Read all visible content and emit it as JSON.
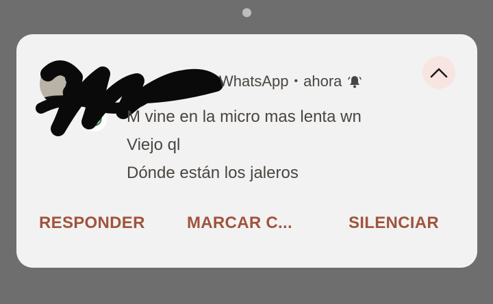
{
  "notification": {
    "app_name": "WhatsApp",
    "separator": "•",
    "time": "ahora",
    "icons": {
      "app_badge": "whatsapp-icon",
      "bell": "bell-icon",
      "collapse": "chevron-up-icon"
    },
    "messages": [
      "M vine en la micro mas lenta wn",
      "Viejo ql",
      "Dónde están los jaleros"
    ],
    "actions": {
      "reply": "RESPONDER",
      "mark": "MARCAR C...",
      "mute": "SILENCIAR"
    }
  },
  "colors": {
    "background": "#6e6e6e",
    "card": "#f2f2f2",
    "action_text": "#a0533d",
    "whatsapp": "#2e8b57"
  }
}
